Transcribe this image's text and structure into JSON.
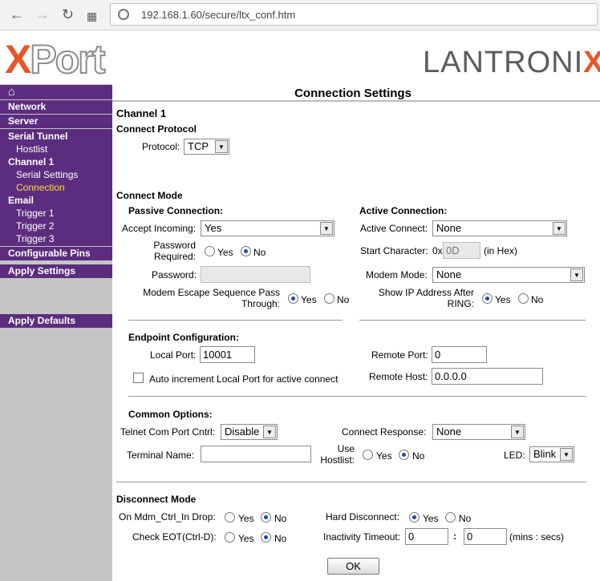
{
  "browser": {
    "url": "192.168.1.60/secure/ltx_conf.htm"
  },
  "header": {
    "logo_x": "X",
    "logo_port": "Port",
    "brand": "LANTRONI",
    "brand_x": "X",
    "brand_reg": "®"
  },
  "sidebar": {
    "home": "⌂",
    "network": "Network",
    "server": "Server",
    "serial_tunnel": "Serial Tunnel",
    "hostlist": "Hostlist",
    "channel1": "Channel 1",
    "serial_settings": "Serial Settings",
    "connection": "Connection",
    "email": "Email",
    "trigger1": "Trigger 1",
    "trigger2": "Trigger 2",
    "trigger3": "Trigger 3",
    "configurable_pins": "Configurable Pins",
    "apply_settings": "Apply Settings",
    "apply_defaults": "Apply Defaults"
  },
  "page": {
    "title": "Connection Settings",
    "channel": "Channel 1"
  },
  "protocol": {
    "section": "Connect Protocol",
    "label": "Protocol:",
    "value": "TCP"
  },
  "mode": {
    "section": "Connect Mode",
    "passive_title": "Passive Connection:",
    "accept_label": "Accept Incoming:",
    "accept_value": "Yes",
    "pwreq_label1": "Password",
    "pwreq_label2": "Required:",
    "password_label": "Password:",
    "escape_label1": "Modem Escape Sequence Pass",
    "escape_label2": "Through:",
    "active_title": "Active Connection:",
    "active_label": "Active Connect:",
    "active_value": "None",
    "startchar_label": "Start Character:",
    "startchar_prefix": "0x",
    "startchar_value": "0D",
    "startchar_suffix": "(in Hex)",
    "modem_label": "Modem Mode:",
    "modem_value": "None",
    "showip_label1": "Show IP Address After",
    "showip_label2": "RING:",
    "yes": "Yes",
    "no": "No"
  },
  "endpoint": {
    "title": "Endpoint Configuration:",
    "local_port_label": "Local Port:",
    "local_port_value": "10001",
    "auto_inc_label": "Auto increment Local Port for active connect",
    "remote_port_label": "Remote Port:",
    "remote_port_value": "0",
    "remote_host_label": "Remote Host:",
    "remote_host_value": "0.0.0.0"
  },
  "common": {
    "title": "Common Options:",
    "telnet_label": "Telnet Com Port Cntrl:",
    "telnet_value": "Disable",
    "response_label": "Connect Response:",
    "response_value": "None",
    "terminal_label": "Terminal Name:",
    "hostlist_label1": "Use",
    "hostlist_label2": "Hostlist:",
    "led_label": "LED:",
    "led_value": "Blink",
    "yes": "Yes",
    "no": "No"
  },
  "disconnect": {
    "section": "Disconnect Mode",
    "mdm_label": "On Mdm_Ctrl_In Drop:",
    "eot_label": "Check EOT(Ctrl-D):",
    "hard_label": "Hard Disconnect:",
    "inactivity_label": "Inactivity Timeout:",
    "inactivity_min": "0",
    "colon": ":",
    "inactivity_sec": "0",
    "units": "(mins : secs)",
    "yes": "Yes",
    "no": "No"
  },
  "ok_label": "OK"
}
